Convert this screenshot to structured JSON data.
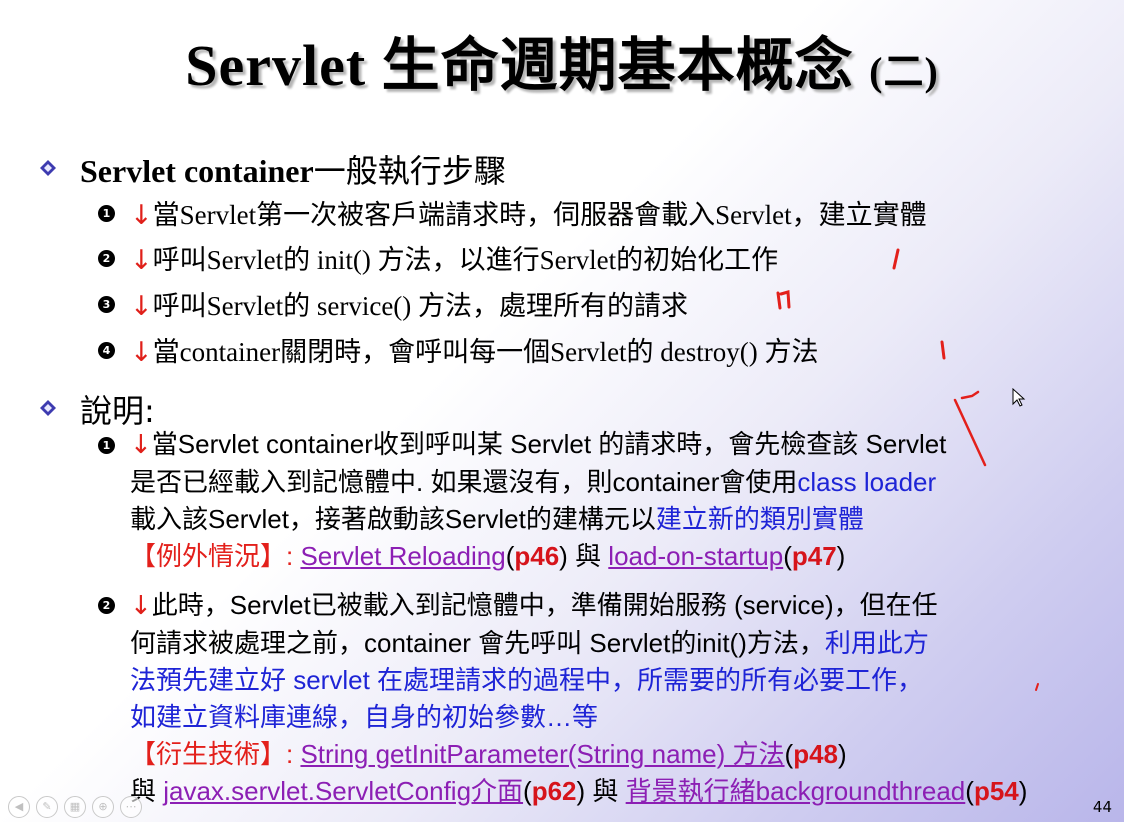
{
  "slide": {
    "title_main": "Servlet 生命週期基本概念 ",
    "title_paren": "(二)",
    "page_number": "44"
  },
  "section1": {
    "heading_bold": "Servlet container",
    "heading_rest": "一般執行步驟",
    "steps": [
      {
        "marker": "1",
        "arrow": "↓",
        "text": "當Servlet第一次被客戶端請求時，伺服器會載入Servlet，建立實體"
      },
      {
        "marker": "2",
        "arrow": "↓",
        "text": "呼叫Servlet的 init() 方法，以進行Servlet的初始化工作"
      },
      {
        "marker": "3",
        "arrow": "↓",
        "text": "呼叫Servlet的 service() 方法，處理所有的請求"
      },
      {
        "marker": "4",
        "arrow": "↓",
        "text": "當container關閉時，會呼叫每一個Servlet的 destroy() 方法"
      }
    ]
  },
  "section2": {
    "heading": "說明:",
    "item1": {
      "marker": "1",
      "arrow": "↓",
      "line1": "當Servlet container收到呼叫某 Servlet 的請求時，會先檢查該 Servlet",
      "line2_a": "是否已經載入到記憶體中. 如果還沒有，則container會使用",
      "line2_b": "class loader",
      "line3_a": "載入該Servlet，接著啟動該Servlet的建構元以",
      "line3_b": "建立新的類別實體",
      "line4_label": "【例外情況】: ",
      "line4_link1": "Servlet Reloading",
      "line4_p1": "p46",
      "line4_and": " 與 ",
      "line4_link2": "load-on-startup",
      "line4_p2": "p47"
    },
    "item2": {
      "marker": "2",
      "arrow": "↓",
      "line1": "此時，Servlet已被載入到記憶體中，準備開始服務 (service)，但在任",
      "line2_a": "何請求被處理之前，container 會先呼叫 Servlet的init()方法，",
      "line2_b": "利用此方",
      "line3": "法預先建立好 servlet 在處理請求的過程中，所需要的所有必要工作，",
      "line4": "如建立資料庫連線，自身的初始參數…等",
      "line5_label": "【衍生技術】: ",
      "line5_link": "String getInitParameter(String name) 方法",
      "line5_p": "p48",
      "line6_and": "與 ",
      "line6_link1": "javax.servlet.ServletConfig介面",
      "line6_p1": "p62",
      "line6_and2": " 與 ",
      "line6_link2": "背景執行緒backgroundthread",
      "line6_p2": "p54"
    }
  },
  "colors": {
    "arrow": "#e0201a",
    "blue": "#1e24d6",
    "link": "#8c1fb4",
    "page_ref": "#d6141b",
    "diamond": "#3d3bb0"
  },
  "icons": [
    "diamond-bullet-icon",
    "mouse-cursor-icon",
    "ink-annotation"
  ]
}
